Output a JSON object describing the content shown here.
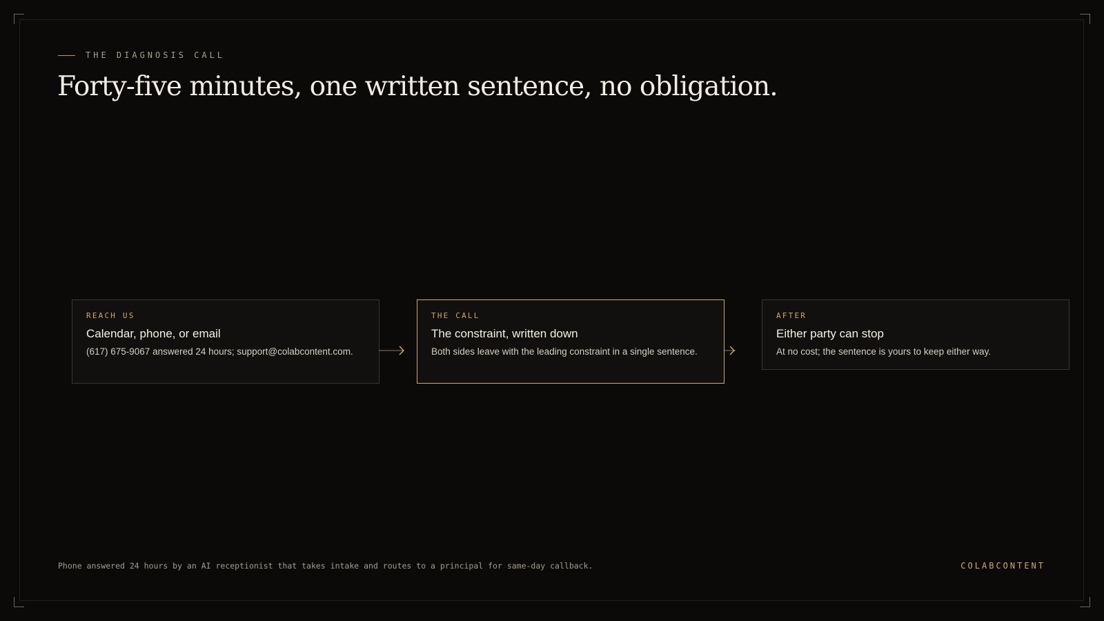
{
  "eyebrow": "THE DIAGNOSIS CALL",
  "headline": "Forty-five minutes, one written sentence, no obligation.",
  "steps": [
    {
      "eyebrow": "REACH US",
      "title": "Calendar, phone, or email",
      "body": "(617) 675-9067 answered 24 hours; support@colabcontent.com."
    },
    {
      "eyebrow": "THE CALL",
      "title": "The constraint, written down",
      "body": "Both sides leave with the leading constraint in a single sentence."
    },
    {
      "eyebrow": "AFTER",
      "title": "Either party can stop",
      "body": "At no cost; the sentence is yours to keep either way."
    }
  ],
  "footnote": "Phone answered 24 hours by an AI receptionist that takes intake and routes to a principal for same-day callback.",
  "brand": "COLABCONTENT",
  "colors": {
    "background": "#0b0a09",
    "accent": "#c9ab80",
    "card_border": "#3a3530",
    "text_primary": "#f1ece4",
    "text_muted": "#a89e90"
  },
  "icons": {
    "connector": "arrow-right-icon"
  }
}
